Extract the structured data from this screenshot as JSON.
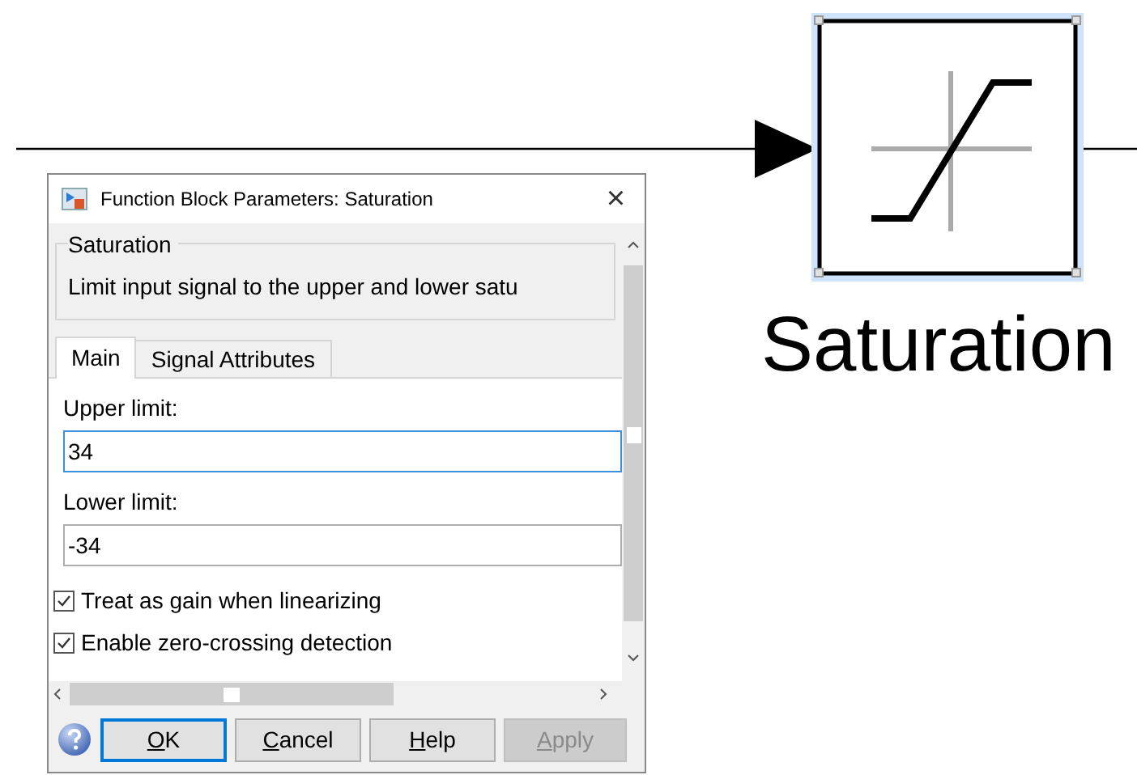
{
  "diagram": {
    "block_label": "Saturation"
  },
  "dialog": {
    "title": "Function Block Parameters: Saturation",
    "close": "×",
    "group": {
      "title": "Saturation",
      "description": "Limit input signal to the upper and lower satu"
    },
    "tabs": [
      {
        "label": "Main",
        "selected": true
      },
      {
        "label": "Signal Attributes",
        "selected": false
      }
    ],
    "fields": [
      {
        "label": "Upper limit:",
        "value": "34",
        "focused": true
      },
      {
        "label": "Lower limit:",
        "value": "-34",
        "focused": false
      }
    ],
    "checkboxes": [
      {
        "label": "Treat as gain when linearizing",
        "checked": true
      },
      {
        "label": "Enable zero-crossing detection",
        "checked": true
      }
    ],
    "buttons": [
      {
        "label": "OK",
        "default": true,
        "disabled": false
      },
      {
        "label": "Cancel",
        "default": false,
        "disabled": false
      },
      {
        "label": "Help",
        "default": false,
        "disabled": false
      },
      {
        "label": "Apply",
        "default": false,
        "disabled": true
      }
    ]
  }
}
